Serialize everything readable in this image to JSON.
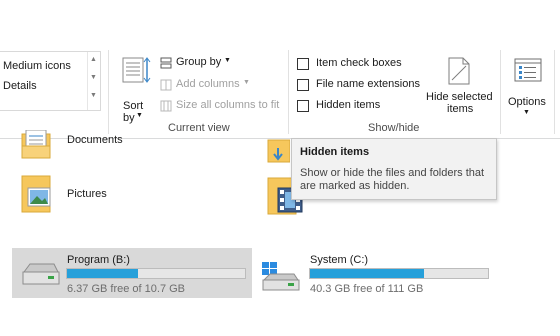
{
  "ribbon": {
    "layout": {
      "items": [
        "Medium icons",
        "Details"
      ]
    },
    "current_view": {
      "group_label": "Current view",
      "sort_by_label": "Sort\nby",
      "sort_line1": "Sort",
      "sort_line2": "by",
      "group_by": "Group by",
      "add_columns": "Add columns",
      "size_all_columns": "Size all columns to fit"
    },
    "show_hide": {
      "group_label": "Show/hide",
      "checkboxes": [
        {
          "label": "Item check boxes",
          "checked": false
        },
        {
          "label": "File name extensions",
          "checked": false
        },
        {
          "label": "Hidden items",
          "checked": false
        }
      ],
      "hide_selected_line1": "Hide selected",
      "hide_selected_line2": "items"
    },
    "options": {
      "label": "Options"
    }
  },
  "tooltip": {
    "title": "Hidden items",
    "description": "Show or hide the files and folders that are marked as hidden."
  },
  "folders": [
    {
      "name": "Documents",
      "icon": "documents-folder-icon"
    },
    {
      "name": "Pictures",
      "icon": "pictures-folder-icon"
    }
  ],
  "drives": [
    {
      "name": "Program (B:)",
      "free_text": "6.37 GB free of 10.7 GB",
      "used_fraction": 0.4,
      "selected": true
    },
    {
      "name": "System (C:)",
      "free_text": "40.3 GB free of 111 GB",
      "used_fraction": 0.64,
      "selected": false
    }
  ],
  "colors": {
    "accent": "#26a0da",
    "selection": "#d9d9d9",
    "folder": "#f6c75c"
  }
}
